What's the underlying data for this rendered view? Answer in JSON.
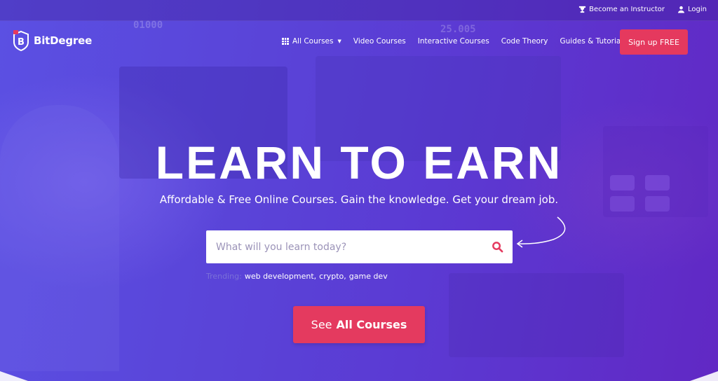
{
  "topbar": {
    "instructor_label": "Become an Instructor",
    "login_label": "Login"
  },
  "logo": {
    "text": "BitDegree"
  },
  "nav": {
    "all_courses": "All Courses",
    "video_courses": "Video Courses",
    "interactive_courses": "Interactive Courses",
    "code_theory": "Code Theory",
    "guides": "Guides & Tutorials",
    "signup": "Sign up FREE"
  },
  "hero": {
    "headline": "LEARN TO EARN",
    "subheadline": "Affordable & Free Online Courses. Gain the knowledge. Get your dream job.",
    "bg_numbers": [
      "01000",
      "25.005"
    ]
  },
  "search": {
    "placeholder": "What will you learn today?",
    "value": ""
  },
  "trending": {
    "label": "Trending:",
    "items": [
      "web development,",
      "crypto,",
      "game dev"
    ]
  },
  "cta": {
    "prefix": "See",
    "bold": "All Courses"
  },
  "colors": {
    "accent": "#e5395e",
    "hero_start": "#5b50e3",
    "hero_end": "#6128c4",
    "trending_label": "#7a70d8"
  },
  "icons": [
    "trophy-icon",
    "user-icon",
    "bitdegree-logo-icon",
    "grid-icon",
    "caret-down-icon",
    "search-icon",
    "curved-arrow-icon"
  ]
}
